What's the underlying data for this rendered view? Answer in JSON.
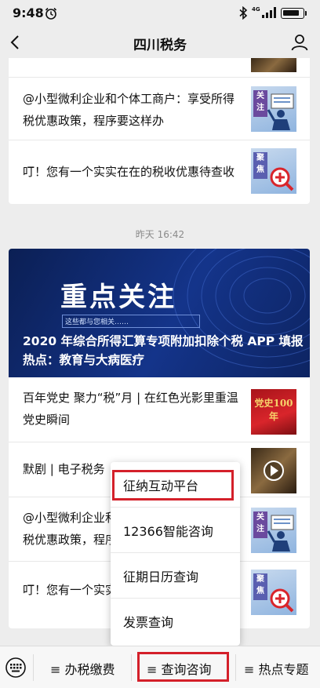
{
  "status_bar": {
    "time": "9:48",
    "network": "4G",
    "battery_level": 0.85
  },
  "nav": {
    "title": "四川税务"
  },
  "top_card": {
    "articles": [
      {
        "text": "@小型微利企业和个体工商户：享受所得税优惠政策，程序要这样办",
        "tag": "关注"
      },
      {
        "text": "叮！您有一个实实在在的税收优惠待查收",
        "tag": "聚焦"
      }
    ]
  },
  "time_divider": "昨天 16:42",
  "main_card": {
    "banner": {
      "heading": "重点关注",
      "subheading": "这些都与您相关……",
      "caption": "2020 年综合所得汇算专项附加扣除个税 APP 填报热点：教育与大病医疗"
    },
    "articles": [
      {
        "text": "百年党史 聚力“税”月 | 在红色光影里重温党史瞬间",
        "thumb_text": "党史100年"
      },
      {
        "text": "默剧 | 电子税务",
        "thumb_text": ""
      },
      {
        "text": "@小型微利企业和",
        "text2": "税优惠政策，程序",
        "tag": "关注"
      },
      {
        "text": "叮！您有一个实实",
        "tag": "聚焦"
      }
    ]
  },
  "popup_menu": {
    "items": [
      "征纳互动平台",
      "12366智能咨询",
      "征期日历查询",
      "发票查询"
    ],
    "highlighted_index": 0
  },
  "bottom_bar": {
    "tabs": [
      "≡ 办税缴费",
      "≡ 查询咨询",
      "≡ 热点专题"
    ],
    "active_index": 1
  },
  "colors": {
    "highlight": "#d4202a",
    "banner": "#14348a",
    "tag": "#6b4a9e"
  }
}
